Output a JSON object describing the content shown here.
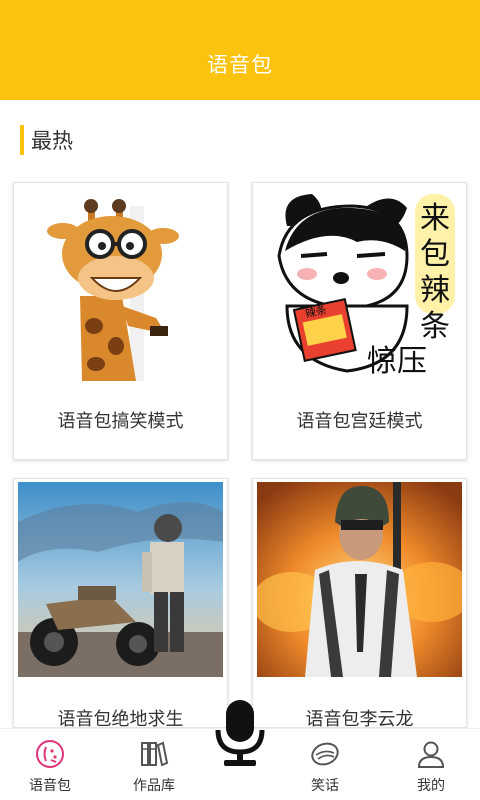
{
  "header": {
    "title": "语音包"
  },
  "section": {
    "title": "最热"
  },
  "cards": [
    {
      "label": "语音包搞笑模式",
      "icon": "giraffe-image"
    },
    {
      "label": "语音包宫廷模式",
      "icon": "dog-sticker-image",
      "sticker_text": "来包辣条压惊",
      "packet_text": "辣条"
    },
    {
      "label": "语音包绝地求生",
      "icon": "motorcycle-soldier-image"
    },
    {
      "label": "语音包李云龙",
      "icon": "helmet-soldier-image"
    }
  ],
  "nav": {
    "items": [
      {
        "label": "语音包",
        "icon": "voice-pack-icon",
        "active": true
      },
      {
        "label": "作品库",
        "icon": "library-icon"
      },
      {
        "label": "笑话",
        "icon": "joke-icon"
      },
      {
        "label": "我的",
        "icon": "profile-icon"
      }
    ],
    "center": {
      "icon": "microphone-icon"
    }
  },
  "colors": {
    "accent": "#FCC30E",
    "active_icon": "#E0347A"
  }
}
